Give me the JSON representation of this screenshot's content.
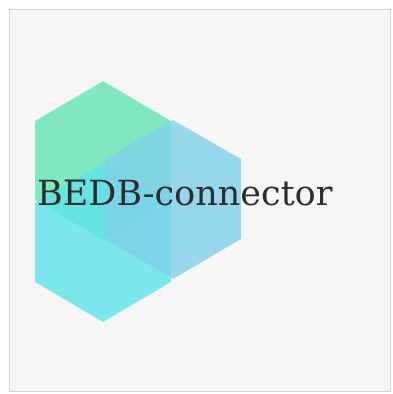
{
  "logo": {
    "wordmark": "BEDB-connector",
    "text_color": "#2a2e2c",
    "colors": {
      "green_hexagon": "#6fe6b8",
      "cyan_hexagon": "#5fe3e6",
      "blue_hexagon": "#7fd0ea",
      "overlap_teal": "#4fd6c8",
      "overlap_blue": "#49c9e3",
      "background": "#f6f6f6",
      "frame_border": "#d4d4d4"
    }
  }
}
